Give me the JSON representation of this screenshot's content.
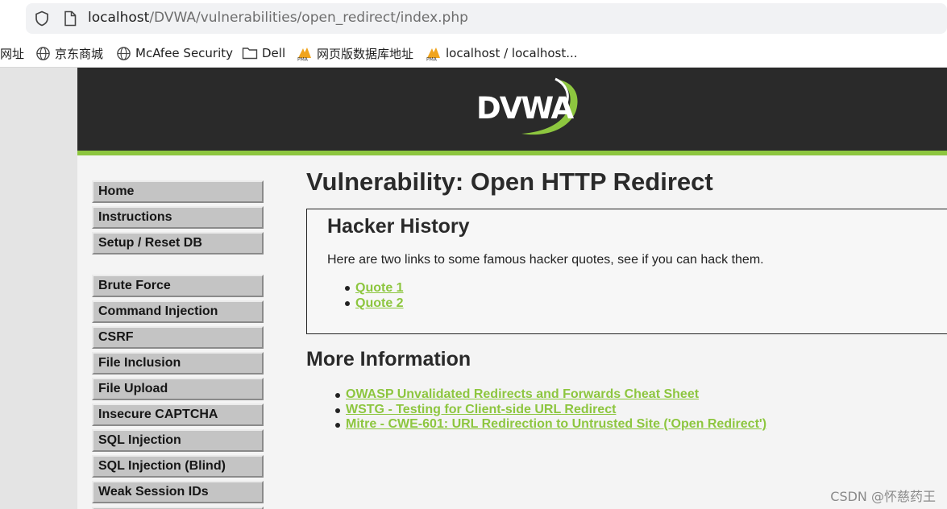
{
  "browser": {
    "url_host": "localhost",
    "url_path": "/DVWA/vulnerabilities/open_redirect/index.php",
    "bookmarks": [
      {
        "label": "网址",
        "icon": "none"
      },
      {
        "label": "京东商城",
        "icon": "globe-icon"
      },
      {
        "label": "McAfee Security",
        "icon": "globe-icon"
      },
      {
        "label": "Dell",
        "icon": "folder-icon"
      },
      {
        "label": "网页版数据库地址",
        "icon": "phpmyadmin-icon"
      },
      {
        "label": "localhost / localhost...",
        "icon": "phpmyadmin-icon"
      }
    ]
  },
  "header": {
    "logo_text": "DVWA"
  },
  "menu": {
    "items": [
      "Home",
      "Instructions",
      "Setup / Reset DB",
      "Brute Force",
      "Command Injection",
      "CSRF",
      "File Inclusion",
      "File Upload",
      "Insecure CAPTCHA",
      "SQL Injection",
      "SQL Injection (Blind)",
      "Weak Session IDs"
    ]
  },
  "main": {
    "title": "Vulnerability: Open HTTP Redirect",
    "box": {
      "heading": "Hacker History",
      "text": "Here are two links to some famous hacker quotes, see if you can hack them.",
      "links": [
        "Quote 1",
        "Quote 2"
      ]
    },
    "more_heading": "More Information",
    "more_links": [
      "OWASP Unvalidated Redirects and Forwards Cheat Sheet",
      "WSTG - Testing for Client-side URL Redirect",
      "Mitre - CWE-601: URL Redirection to Untrusted Site ('Open Redirect')"
    ]
  },
  "watermark": "CSDN @怀慈药王",
  "colors": {
    "accent_green": "#8dc63f",
    "header_dark": "#2a2a2a"
  }
}
